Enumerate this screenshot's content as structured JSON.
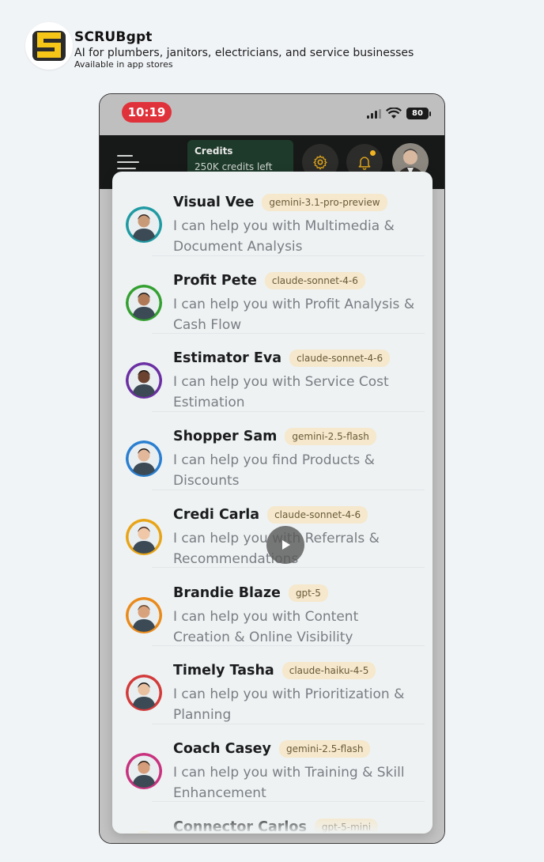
{
  "brand": {
    "title": "SCRUBgpt",
    "subtitle": "AI for plumbers, janitors, electricians, and service businesses",
    "availability": "Available in app stores",
    "logo_colors": [
      "#f5c518",
      "#2b2b2b"
    ]
  },
  "status_bar": {
    "time": "10:19",
    "battery": "80",
    "time_pill_color": "#e0323b"
  },
  "top_bar": {
    "credits_title": "Credits",
    "credits_value": "250K credits left",
    "icons": [
      "menu-icon",
      "gear-icon",
      "bell-icon"
    ],
    "accent": "#f2b522"
  },
  "agents": [
    {
      "name": "Visual Vee",
      "model": "gemini-3.1-pro-preview",
      "description": "I can help you with Multimedia & Document Analysis",
      "ring": "#1f9aa3"
    },
    {
      "name": "Profit Pete",
      "model": "claude-sonnet-4-6",
      "description": "I can help you with Profit Analysis & Cash Flow",
      "ring": "#34a030"
    },
    {
      "name": "Estimator Eva",
      "model": "claude-sonnet-4-6",
      "description": "I can help you with Service Cost Estimation",
      "ring": "#6b2fa3"
    },
    {
      "name": "Shopper Sam",
      "model": "gemini-2.5-flash",
      "description": "I can help you find Products & Discounts",
      "ring": "#2a7fd1"
    },
    {
      "name": "Credi Carla",
      "model": "claude-sonnet-4-6",
      "description": "I can help you with Referrals & Recommendations",
      "ring": "#e8a416"
    },
    {
      "name": "Brandie Blaze",
      "model": "gpt-5",
      "description": "I can help you with Content Creation & Online Visibility",
      "ring": "#ea8a1a"
    },
    {
      "name": "Timely Tasha",
      "model": "claude-haiku-4-5",
      "description": "I can help you with Prioritization & Planning",
      "ring": "#d33a3a"
    },
    {
      "name": "Coach Casey",
      "model": "gemini-2.5-flash",
      "description": "I can help you with Training & Skill Enhancement",
      "ring": "#c8327e"
    },
    {
      "name": "Connector Carlos",
      "model": "gpt-5-mini",
      "description": "",
      "ring": "#f5c518"
    }
  ]
}
